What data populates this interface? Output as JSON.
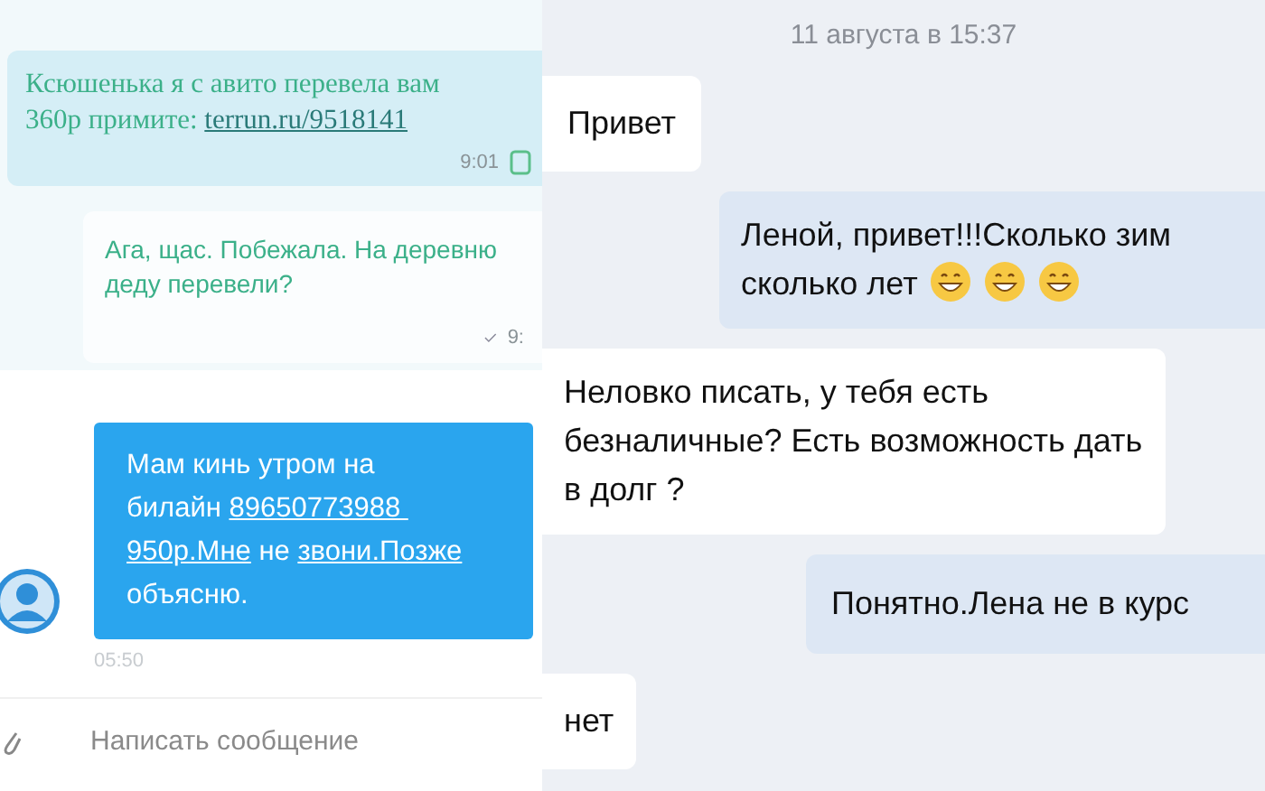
{
  "sms_chat": {
    "messages": [
      {
        "segments": [
          {
            "text": "Ксюшенька я с авито перевела вам 360р примите: "
          },
          {
            "text": "terrun.ru/9518141",
            "link": true
          }
        ],
        "time": "9:01",
        "delivered": false
      },
      {
        "segments": [
          {
            "text": "Ага, щас. Побежала. На деревню деду перевели?"
          }
        ],
        "time": "9:",
        "delivered": true
      }
    ]
  },
  "messenger_chat": {
    "messages": [
      {
        "segments": [
          {
            "text": "Мам кинь утром на билайн "
          },
          {
            "text": "89650773988 ",
            "link": true
          },
          {
            "text": "950р.Мне",
            "link": true
          },
          {
            "text": " не "
          },
          {
            "text": "звони.Позже",
            "link": true
          },
          {
            "text": " объясню."
          }
        ],
        "time": "05:50"
      }
    ],
    "input": {
      "placeholder": "Написать сообщение"
    }
  },
  "social_chat": {
    "date": "11 августа в 15:37",
    "messages": [
      {
        "outgoing": false,
        "text": "Привет"
      },
      {
        "outgoing": true,
        "text": "Леной, привет!!!Сколько зим сколько лет",
        "emojis": [
          {
            "kind": "grin"
          },
          {
            "kind": "grin"
          },
          {
            "kind": "grin"
          }
        ]
      },
      {
        "outgoing": false,
        "text": "Неловко писать, у тебя есть безналичные? Есть возможность дать в долг ?"
      },
      {
        "outgoing": true,
        "text": "Понятно.Лена не в курс"
      },
      {
        "outgoing": false,
        "text": "нет"
      }
    ]
  }
}
